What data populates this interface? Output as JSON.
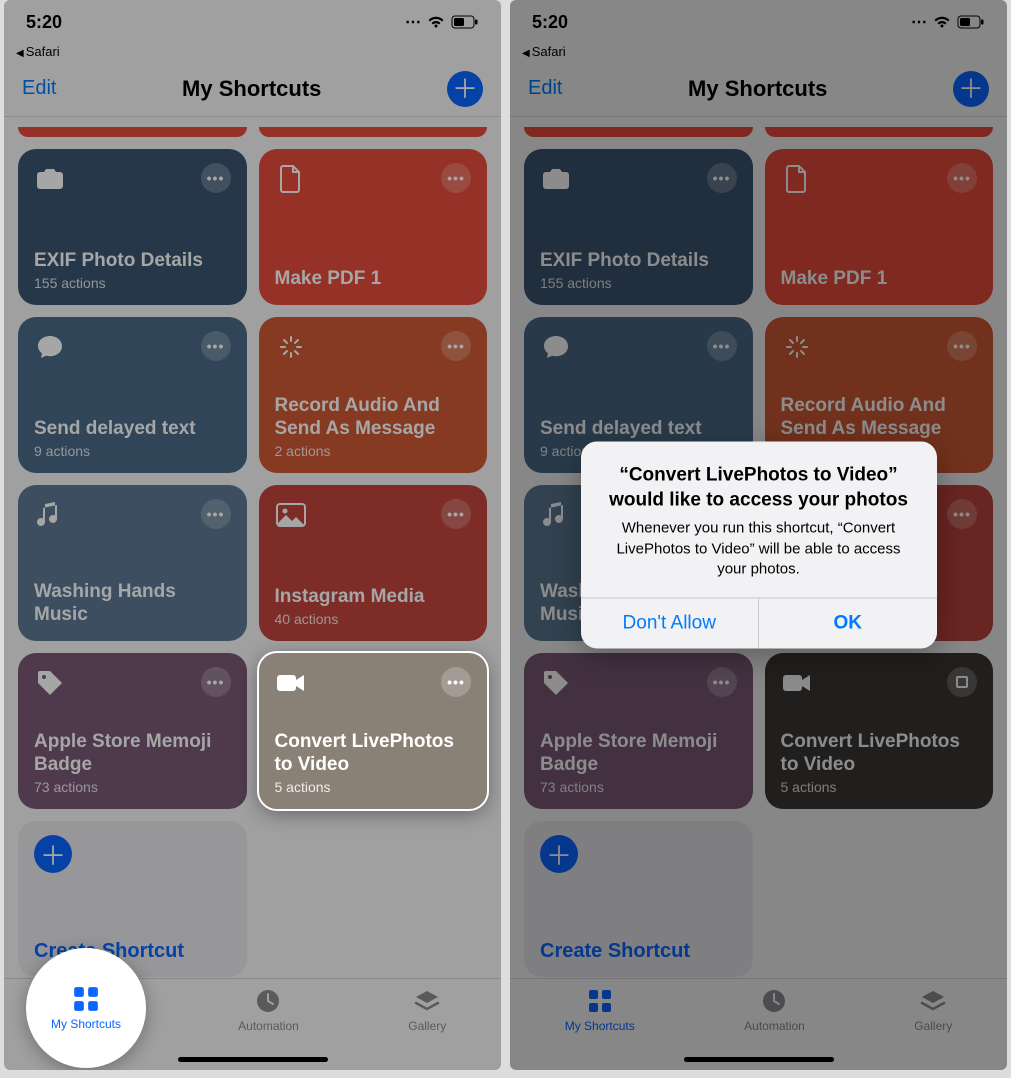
{
  "status": {
    "time": "5:20",
    "back_app": "Safari"
  },
  "nav": {
    "edit": "Edit",
    "title": "My Shortcuts"
  },
  "colors": {
    "red_top": "#e74c3c",
    "dark_blue": "#3b5572",
    "red": "#e74c3c",
    "steel": "#4a6a88",
    "orange": "#d05a35",
    "slate": "#5c7893",
    "crimson": "#c0443d",
    "plum": "#7a5a77",
    "gray": "#8a8176",
    "dark_gray": "#3d3a36"
  },
  "cards": [
    {
      "id": "exif",
      "title": "EXIF Photo Details",
      "sub": "155 actions",
      "icon": "camera",
      "colorKey": "dark_blue"
    },
    {
      "id": "pdf",
      "title": "Make PDF 1",
      "sub": "",
      "icon": "doc",
      "colorKey": "red"
    },
    {
      "id": "delay",
      "title": "Send delayed text",
      "sub": "9 actions",
      "icon": "chat",
      "colorKey": "steel"
    },
    {
      "id": "audio",
      "title": "Record Audio And Send As Message",
      "sub": "2 actions",
      "icon": "wand",
      "colorKey": "orange"
    },
    {
      "id": "wash",
      "title": "Washing Hands Music",
      "sub": "",
      "icon": "music",
      "colorKey": "slate"
    },
    {
      "id": "insta",
      "title": "Instagram Media",
      "sub": "40 actions",
      "icon": "image",
      "colorKey": "crimson"
    },
    {
      "id": "memoji",
      "title": "Apple Store Memoji Badge",
      "sub": "73 actions",
      "icon": "tag",
      "colorKey": "plum"
    },
    {
      "id": "live",
      "title": "Convert LivePhotos to Video",
      "sub": "5 actions",
      "icon": "video",
      "colorKey": "gray"
    }
  ],
  "create": {
    "label": "Create Shortcut"
  },
  "tabs": {
    "shortcuts": "My Shortcuts",
    "automation": "Automation",
    "gallery": "Gallery"
  },
  "alert": {
    "title": "“Convert LivePhotos to Video” would like to access your photos",
    "message": "Whenever you run this shortcut, “Convert LivePhotos to Video” will be able to access your photos.",
    "dont_allow": "Don't Allow",
    "ok": "OK"
  }
}
